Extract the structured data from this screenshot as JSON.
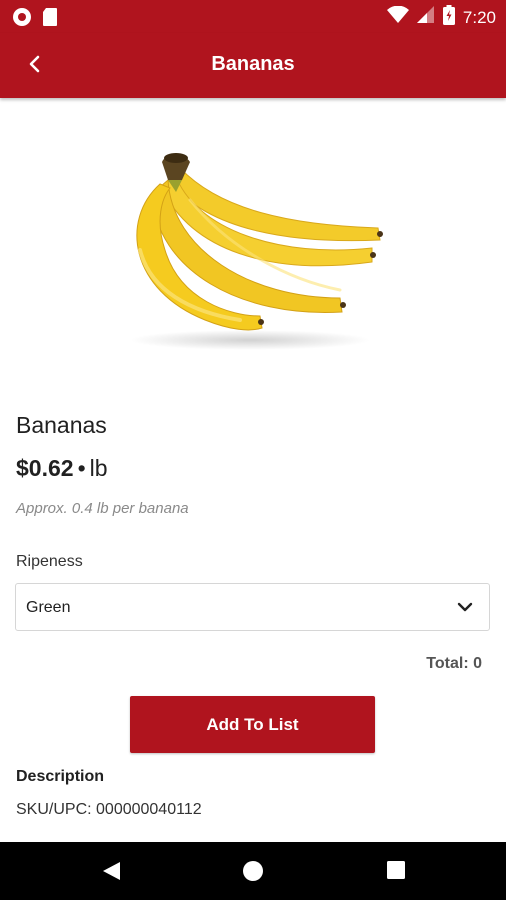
{
  "status_bar": {
    "time": "7:20"
  },
  "header": {
    "title": "Bananas"
  },
  "product": {
    "name": "Bananas",
    "price": "$0.62",
    "separator": "•",
    "unit": "lb",
    "approx": "Approx. 0.4 lb per banana",
    "image_icon": "bananas-product-image"
  },
  "ripeness": {
    "label": "Ripeness",
    "selected": "Green"
  },
  "total": "Total: 0",
  "add_button": "Add To List",
  "description": {
    "heading": "Description",
    "sku": "SKU/UPC: 000000040112"
  },
  "colors": {
    "brand_red": "#b0141e",
    "nav_black": "#000000",
    "banana_yellow": "#f2c81e"
  },
  "icons": {
    "back": "chevron-left-icon",
    "dropdown": "chevron-down-icon",
    "nav_back": "triangle-back-icon",
    "nav_home": "circle-home-icon",
    "nav_recents": "square-recents-icon"
  }
}
